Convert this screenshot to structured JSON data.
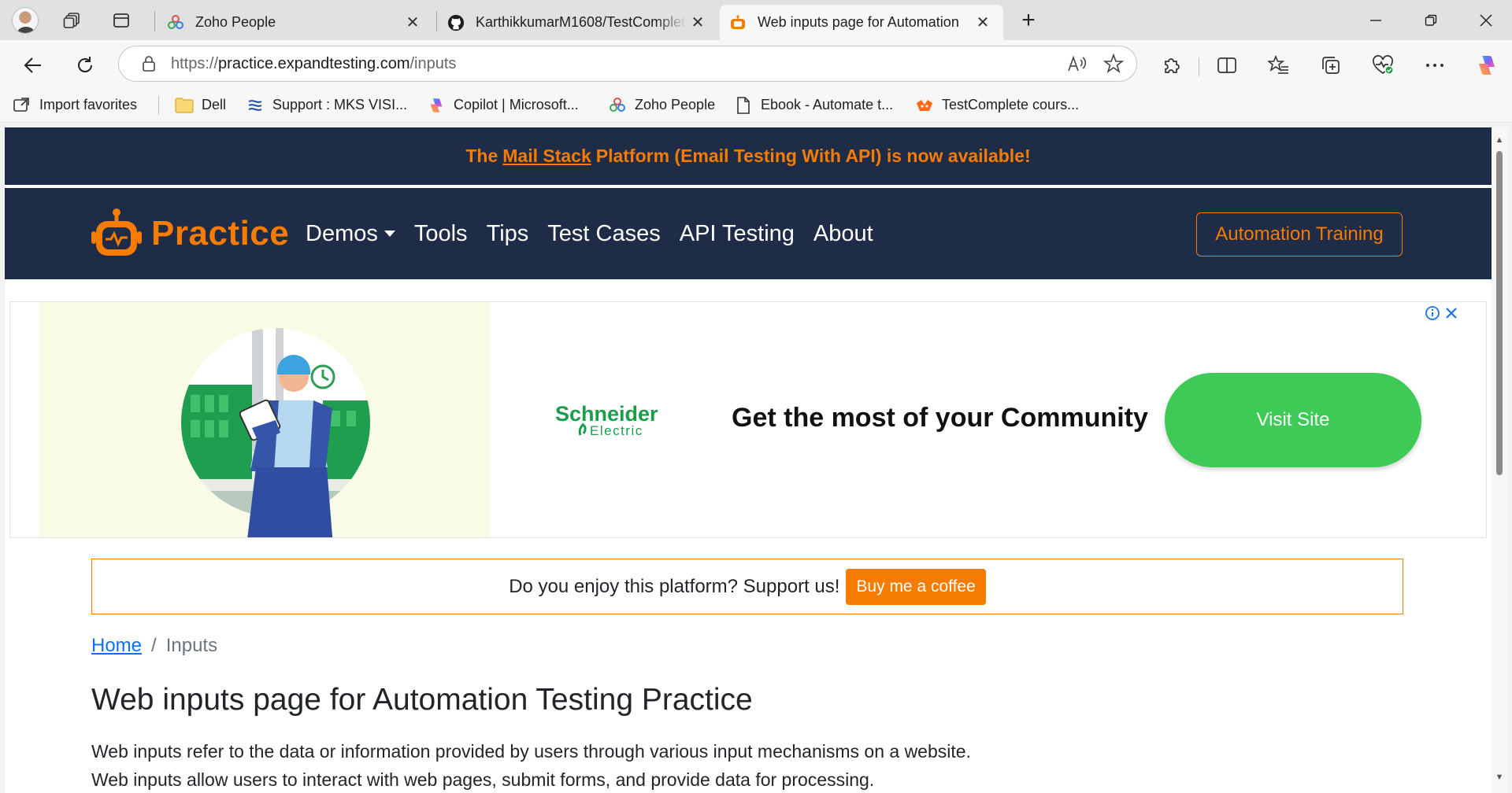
{
  "browser": {
    "tabs": [
      {
        "label": "Zoho People",
        "active": false
      },
      {
        "label": "KarthikkumarM1608/TestComplete",
        "active": false
      },
      {
        "label": "Web inputs page for Automation",
        "active": true
      }
    ],
    "close_glyph": "✕",
    "new_tab_glyph": "+",
    "window_controls": {
      "minimize": "—",
      "restore": "❐",
      "close": "✕"
    },
    "address": {
      "scheme": "https://",
      "host": "practice.expandtesting.com",
      "path": "/inputs"
    },
    "favorites": [
      {
        "label": "Import favorites",
        "icon": "import-favorites-icon"
      },
      {
        "label": "Dell",
        "icon": "folder-icon"
      },
      {
        "label": "Support : MKS VISI...",
        "icon": "mks-icon"
      },
      {
        "label": "Copilot | Microsoft...",
        "icon": "copilot-icon"
      },
      {
        "label": "Zoho People",
        "icon": "zoho-icon"
      },
      {
        "label": "Ebook - Automate t...",
        "icon": "document-icon"
      },
      {
        "label": "TestComplete cours...",
        "icon": "testcomplete-icon"
      }
    ]
  },
  "page": {
    "promo": {
      "prefix": "The",
      "link": "Mail Stack",
      "suffix": "Platform (Email Testing With API) is now available!"
    },
    "brand": "Practice",
    "nav": [
      {
        "label": "Demos",
        "dropdown": true
      },
      {
        "label": "Tools",
        "dropdown": false
      },
      {
        "label": "Tips",
        "dropdown": false
      },
      {
        "label": "Test Cases",
        "dropdown": false
      },
      {
        "label": "API Testing",
        "dropdown": false
      },
      {
        "label": "About",
        "dropdown": false
      }
    ],
    "training_button": "Automation Training",
    "ad": {
      "brand_line1": "Schneider",
      "brand_line2": "Electric",
      "headline": "Get the most of your Community",
      "cta": "Visit Site"
    },
    "support": {
      "text": "Do you enjoy this platform? Support us!",
      "button": "Buy me a coffee"
    },
    "breadcrumb": {
      "home": "Home",
      "separator": "/",
      "current": "Inputs"
    },
    "title": "Web inputs page for Automation Testing Practice",
    "intro_lines": [
      "Web inputs refer to the data or information provided by users through various input mechanisms on a website.",
      "Web inputs allow users to interact with web pages, submit forms, and provide data for processing."
    ]
  },
  "colors": {
    "navy": "#1e2c48",
    "accent": "#f57c00",
    "cta_green": "#3dca56",
    "link_blue": "#0d6efd"
  }
}
